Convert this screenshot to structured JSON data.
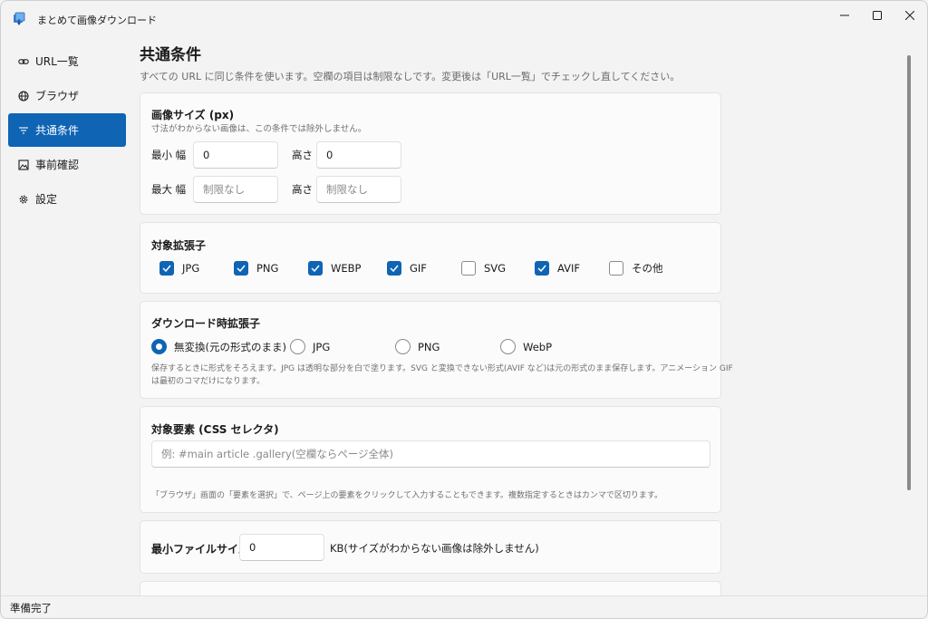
{
  "window": {
    "title": "まとめて画像ダウンロード"
  },
  "sidebar": {
    "items": [
      {
        "label": "URL一覧",
        "icon": "link-icon"
      },
      {
        "label": "ブラウザ",
        "icon": "globe-icon"
      },
      {
        "label": "共通条件",
        "icon": "filter-icon",
        "active": true
      },
      {
        "label": "事前確認",
        "icon": "image-icon"
      },
      {
        "label": "設定",
        "icon": "gear-icon"
      }
    ]
  },
  "page": {
    "title": "共通条件",
    "description": "すべての URL に同じ条件を使います。空欄の項目は制限なしです。変更後は「URL一覧」でチェックし直してください。"
  },
  "image_size": {
    "title": "画像サイズ (px)",
    "hint": "寸法がわからない画像は、この条件では除外しません。",
    "min_width_label": "最小 幅",
    "min_width_value": "0",
    "min_height_label": "高さ",
    "min_height_value": "0",
    "max_width_label": "最大 幅",
    "max_width_placeholder": "制限なし",
    "max_height_label": "高さ",
    "max_height_placeholder": "制限なし"
  },
  "extensions": {
    "title": "対象拡張子",
    "items": [
      {
        "label": "JPG",
        "checked": true
      },
      {
        "label": "PNG",
        "checked": true
      },
      {
        "label": "WEBP",
        "checked": true
      },
      {
        "label": "GIF",
        "checked": true
      },
      {
        "label": "SVG",
        "checked": false
      },
      {
        "label": "AVIF",
        "checked": true
      },
      {
        "label": "その他",
        "checked": false
      }
    ]
  },
  "download_ext": {
    "title": "ダウンロード時拡張子",
    "options": [
      {
        "label": "無変換(元の形式のまま)",
        "selected": true
      },
      {
        "label": "JPG",
        "selected": false
      },
      {
        "label": "PNG",
        "selected": false
      },
      {
        "label": "WebP",
        "selected": false
      }
    ],
    "hint_line1": "保存するときに形式をそろえます。JPG は透明な部分を白で塗ります。SVG と変換できない形式(AVIF など)は元の形式のまま保存します。アニメーション GIF",
    "hint_line2": "は最初のコマだけになります。"
  },
  "selector": {
    "title": "対象要素 (CSS セレクタ)",
    "placeholder": "例: #main article .gallery(空欄ならページ全体)",
    "hint": "「ブラウザ」画面の「要素を選択」で、ページ上の要素をクリックして入力することもできます。複数指定するときはカンマで区切ります。"
  },
  "min_file_size": {
    "label": "最小ファイルサイズ",
    "value": "0",
    "unit_note": "KB(サイズがわからない画像は除外しません)"
  },
  "status": {
    "text": "準備完了"
  },
  "colors": {
    "accent": "#0f64b4"
  }
}
